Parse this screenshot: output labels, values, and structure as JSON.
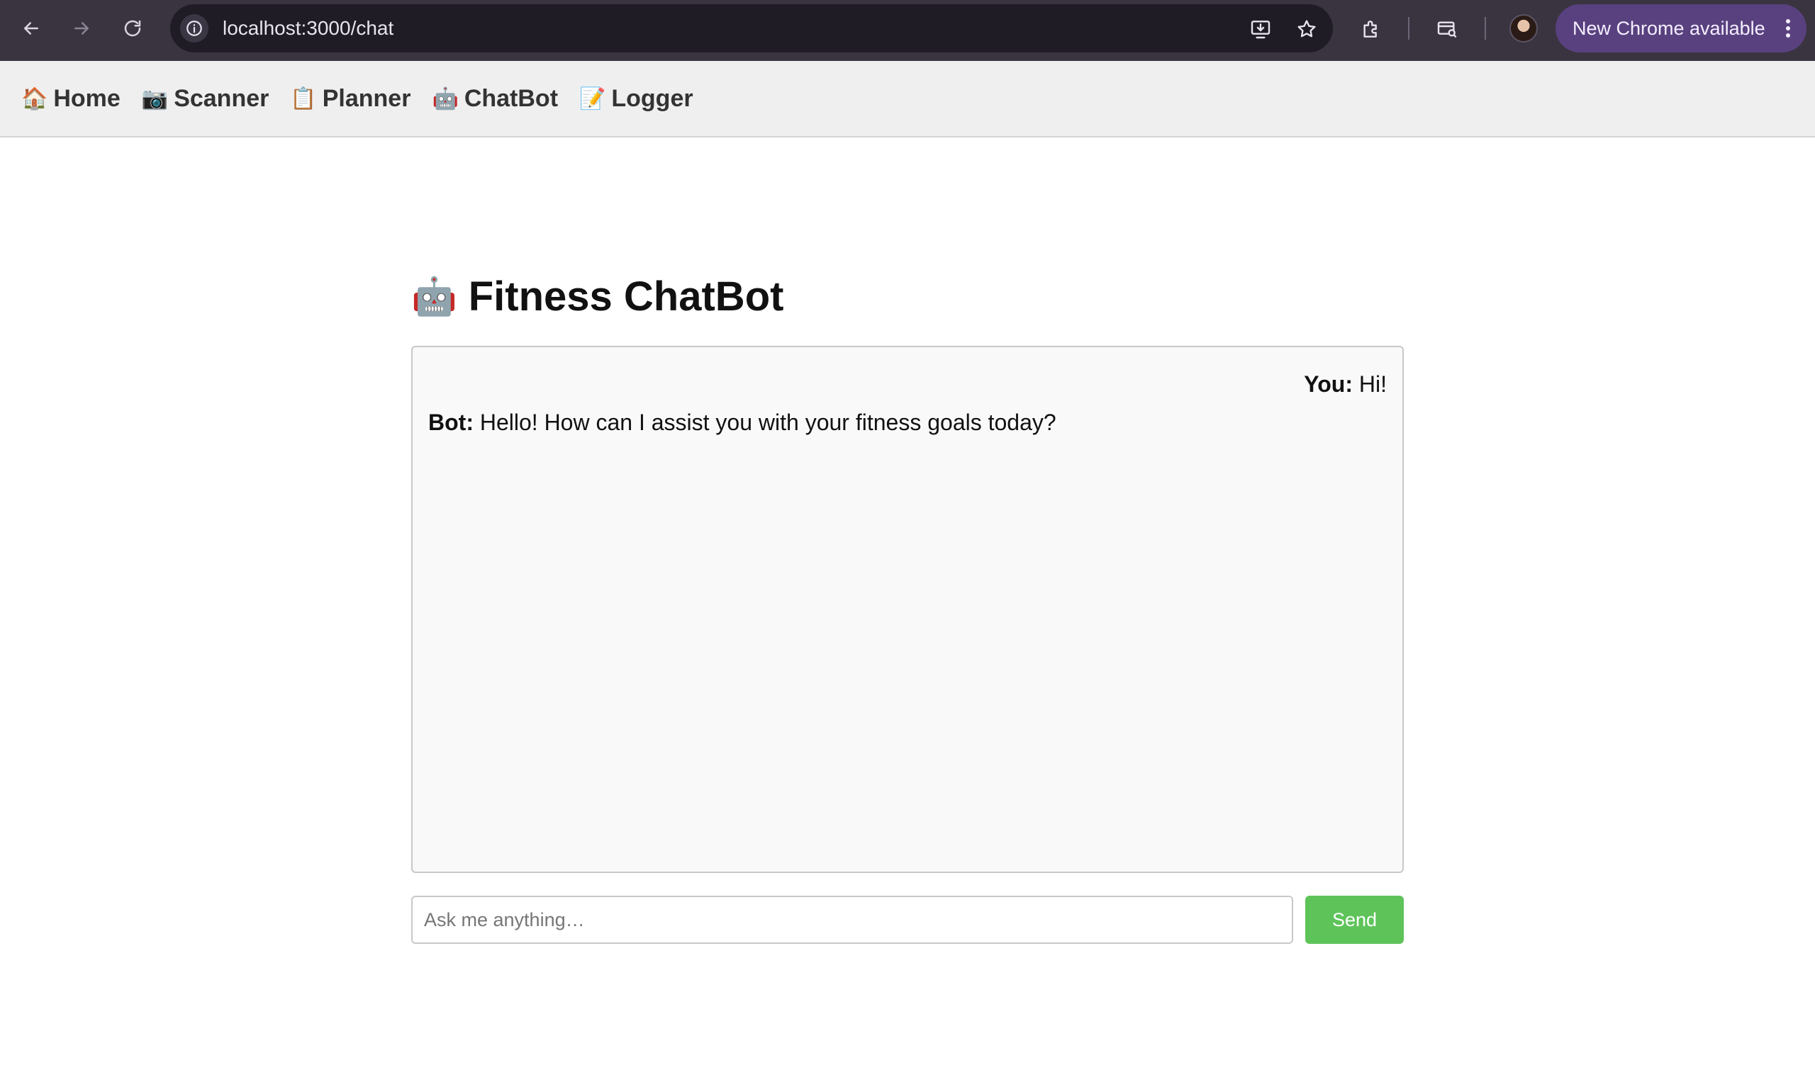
{
  "browser": {
    "url": "localhost:3000/chat",
    "update_label": "New Chrome available",
    "icons": {
      "back": "arrow-left-icon",
      "forward": "arrow-right-icon",
      "reload": "reload-icon",
      "site_info": "info-icon",
      "install": "install-app-icon",
      "bookmark": "star-icon",
      "extensions": "puzzle-icon",
      "search_tabs": "tab-search-icon",
      "profile": "avatar",
      "menu": "kebab-menu-icon"
    }
  },
  "nav": {
    "items": [
      {
        "emoji": "🏠",
        "label": "Home"
      },
      {
        "emoji": "📷",
        "label": "Scanner"
      },
      {
        "emoji": "📋",
        "label": "Planner"
      },
      {
        "emoji": "🤖",
        "label": "ChatBot"
      },
      {
        "emoji": "📝",
        "label": "Logger"
      }
    ]
  },
  "page": {
    "title_emoji": "🤖",
    "title": "Fitness ChatBot"
  },
  "chat": {
    "messages": [
      {
        "sender": "You:",
        "text": "Hi!"
      },
      {
        "sender": "Bot:",
        "text": "Hello! How can I assist you with your fitness goals today?"
      }
    ],
    "input_placeholder": "Ask me anything…",
    "input_value": "",
    "send_label": "Send"
  },
  "colors": {
    "chrome_bg": "#3a3441",
    "omnibox_bg": "#201c26",
    "update_pill": "#59417f",
    "nav_bg": "#efefef",
    "send_button": "#5ec45a"
  }
}
